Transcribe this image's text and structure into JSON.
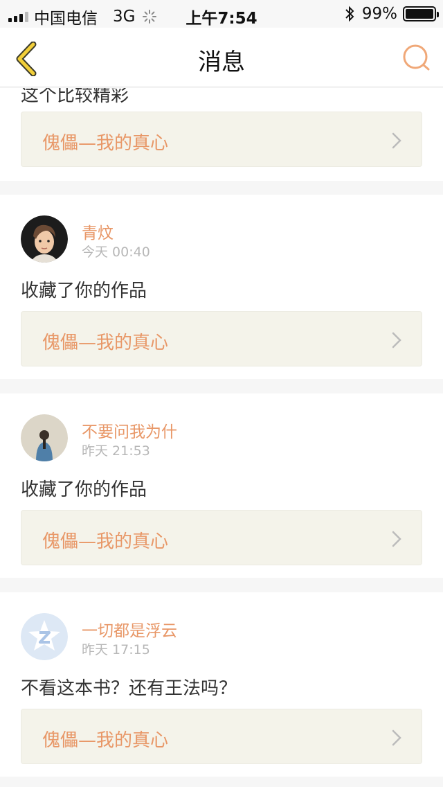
{
  "status_bar": {
    "carrier": "中国电信",
    "network": "3G",
    "time": "上午7:54",
    "battery": "99%",
    "battery_level": 0.99
  },
  "nav": {
    "title": "消息",
    "back_icon": "back-chevron-icon",
    "search_icon": "search-icon"
  },
  "colors": {
    "accent": "#e89767",
    "back_yellow": "#f2cf3a",
    "link_bg": "#f4f3ea"
  },
  "messages": [
    {
      "partial_text": "这个比较精彩",
      "work_title": "傀儡—我的真心"
    },
    {
      "username": "青炆",
      "time": "今天 00:40",
      "text": "收藏了你的作品",
      "work_title": "傀儡—我的真心"
    },
    {
      "username": "不要问我为什",
      "time": "昨天 21:53",
      "text": "收藏了你的作品",
      "work_title": "傀儡—我的真心"
    },
    {
      "username": "一切都是浮云",
      "time": "昨天 17:15",
      "text": "不看这本书？还有王法吗？",
      "work_title": "傀儡—我的真心"
    }
  ]
}
